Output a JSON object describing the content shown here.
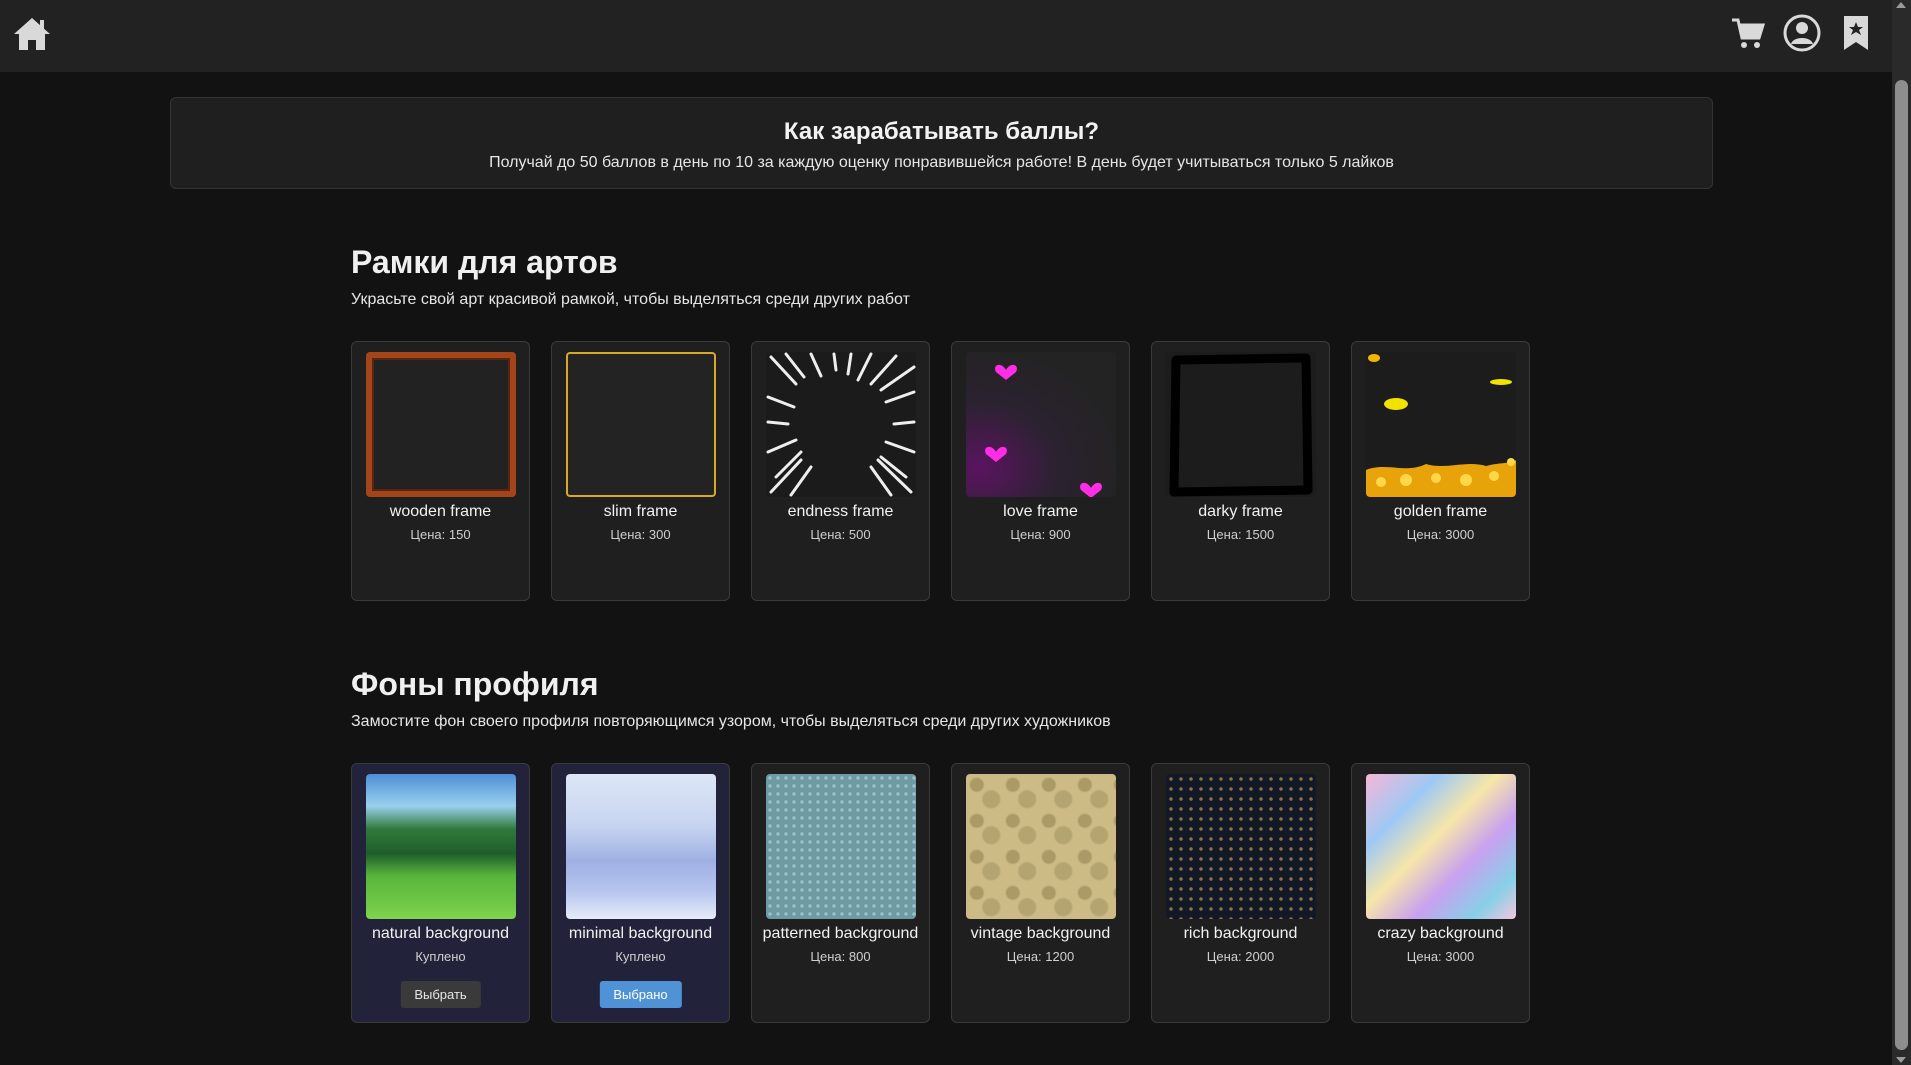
{
  "header": {
    "home_icon": "home-icon",
    "right_icons": [
      "cart-icon",
      "user-icon",
      "bookmark-icon"
    ]
  },
  "info": {
    "title": "Как зарабатывать баллы?",
    "text": "Получай до 50 баллов в день по 10 за каждую оценку понравившейся работе! В день будет учитываться только 5 лайков"
  },
  "frames": {
    "title": "Рамки для артов",
    "subtitle": "Украсьте свой арт красивой рамкой, чтобы выделяться среди других работ",
    "items": [
      {
        "name": "wooden frame",
        "price": "Цена: 150"
      },
      {
        "name": "slim frame",
        "price": "Цена: 300"
      },
      {
        "name": "endness frame",
        "price": "Цена: 500"
      },
      {
        "name": "love frame",
        "price": "Цена: 900"
      },
      {
        "name": "darky frame",
        "price": "Цена: 1500"
      },
      {
        "name": "golden frame",
        "price": "Цена: 3000"
      }
    ]
  },
  "backgrounds": {
    "title": "Фоны профиля",
    "subtitle": "Замостите фон своего профиля повторяющимся узором, чтобы выделяться среди других художников",
    "items": [
      {
        "name": "natural background",
        "price": "Куплено",
        "button": "Выбрать"
      },
      {
        "name": "minimal background",
        "price": "Куплено",
        "button": "Выбрано"
      },
      {
        "name": "patterned background",
        "price": "Цена: 800"
      },
      {
        "name": "vintage background",
        "price": "Цена: 1200"
      },
      {
        "name": "rich background",
        "price": "Цена: 2000"
      },
      {
        "name": "crazy background",
        "price": "Цена: 3000"
      }
    ]
  },
  "colors": {
    "page_bg": "#121212",
    "header_bg": "#222222",
    "selected_button": "#4f93d6",
    "owned_card_bg": "#22233a"
  }
}
